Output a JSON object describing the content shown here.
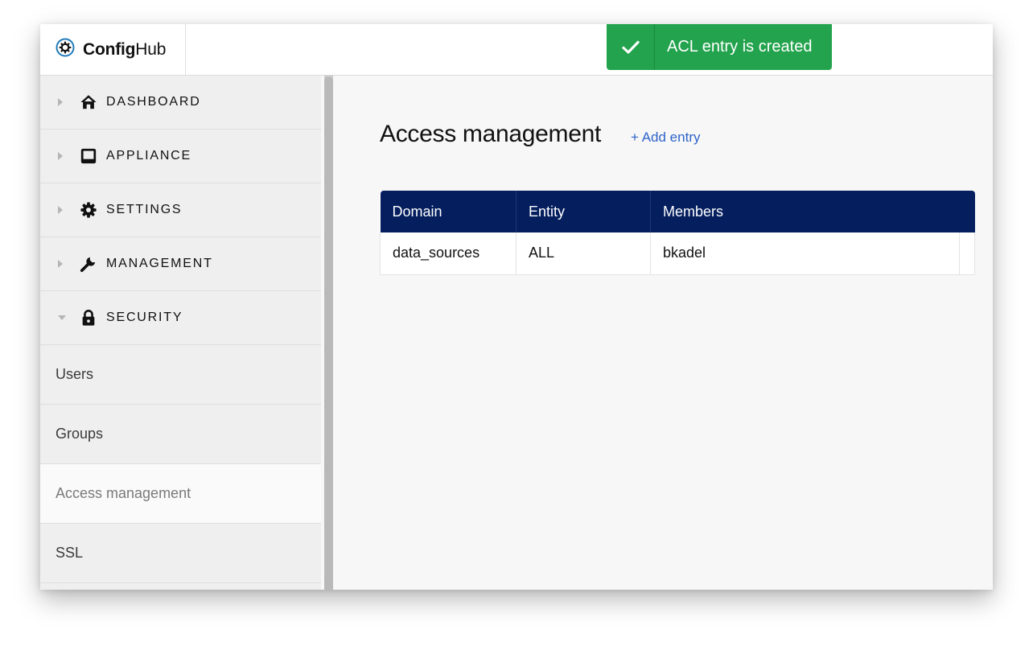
{
  "brand": {
    "name_bold": "Config",
    "name_regular": "Hub"
  },
  "toast": {
    "message": "ACL entry is created",
    "color": "#23a34d"
  },
  "sidebar": {
    "sections": [
      {
        "label": "DASHBOARD",
        "icon": "home-icon",
        "expanded": false
      },
      {
        "label": "APPLIANCE",
        "icon": "appliance-icon",
        "expanded": false
      },
      {
        "label": "SETTINGS",
        "icon": "gear-icon",
        "expanded": false
      },
      {
        "label": "MANAGEMENT",
        "icon": "wrench-icon",
        "expanded": false
      },
      {
        "label": "SECURITY",
        "icon": "lock-icon",
        "expanded": true
      }
    ],
    "security_items": [
      {
        "label": "Users"
      },
      {
        "label": "Groups"
      },
      {
        "label": "Access management",
        "active": true
      },
      {
        "label": "SSL"
      }
    ]
  },
  "main": {
    "title": "Access management",
    "add_entry_label": "+ Add entry",
    "table": {
      "columns": [
        "Domain",
        "Entity",
        "Members"
      ],
      "rows": [
        [
          "data_sources",
          "ALL",
          "bkadel"
        ]
      ],
      "header_color": "#041e5e"
    }
  },
  "colors": {
    "accent_link": "#2f63c9",
    "success": "#23a34d",
    "table_header": "#041e5e"
  }
}
